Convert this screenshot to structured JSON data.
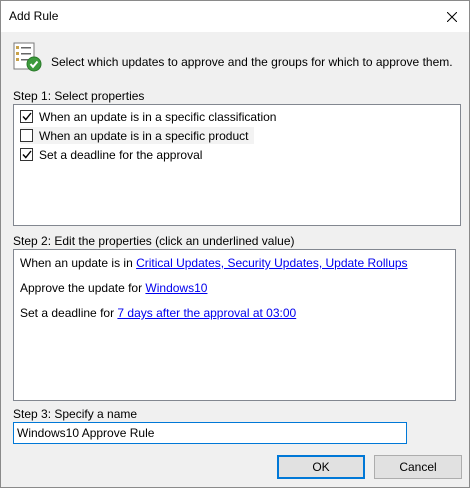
{
  "window": {
    "title": "Add Rule"
  },
  "header": {
    "instruction": "Select which updates to approve and the groups for which to approve them."
  },
  "step1": {
    "label": "Step 1: Select properties",
    "items": [
      {
        "label": "When an update is in a specific classification",
        "checked": true
      },
      {
        "label": "When an update is in a specific product",
        "checked": false
      },
      {
        "label": "Set a deadline for the approval",
        "checked": true
      }
    ]
  },
  "step2": {
    "label": "Step 2: Edit the properties (click an underlined value)",
    "lines": [
      {
        "prefix": "When an update is in ",
        "link": "Critical Updates, Security Updates, Update Rollups"
      },
      {
        "prefix": "Approve the update for ",
        "link": "Windows10"
      },
      {
        "prefix": "Set a deadline for ",
        "link": "7 days after the approval at 03:00"
      }
    ]
  },
  "step3": {
    "label": "Step 3: Specify a name",
    "value": "Windows10 Approve Rule"
  },
  "buttons": {
    "ok": "OK",
    "cancel": "Cancel"
  },
  "colors": {
    "link": "#0000ee",
    "focus": "#0078d7"
  }
}
